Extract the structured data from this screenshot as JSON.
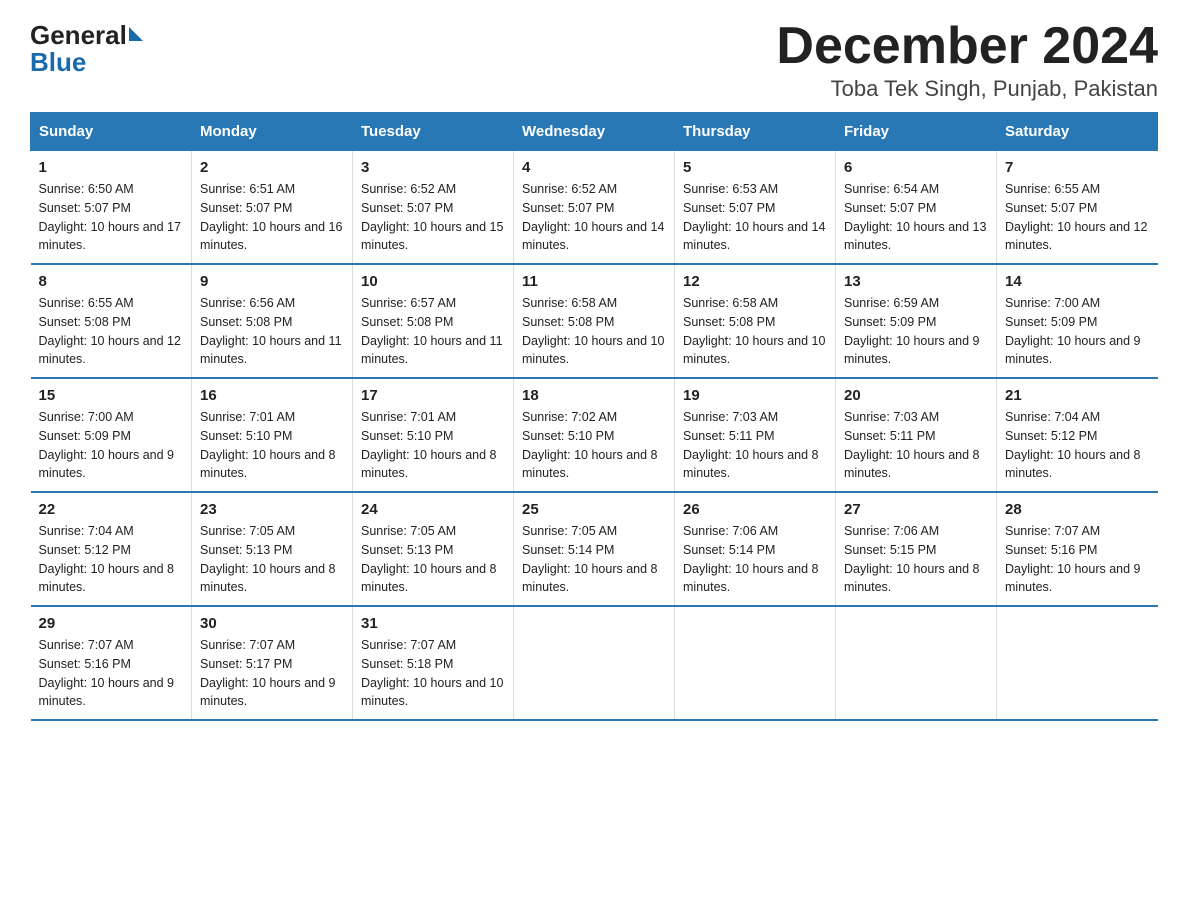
{
  "header": {
    "logo_general": "General",
    "logo_blue": "Blue",
    "month_title": "December 2024",
    "location": "Toba Tek Singh, Punjab, Pakistan"
  },
  "days_of_week": [
    "Sunday",
    "Monday",
    "Tuesday",
    "Wednesday",
    "Thursday",
    "Friday",
    "Saturday"
  ],
  "weeks": [
    [
      {
        "day": "1",
        "sunrise": "6:50 AM",
        "sunset": "5:07 PM",
        "daylight": "10 hours and 17 minutes."
      },
      {
        "day": "2",
        "sunrise": "6:51 AM",
        "sunset": "5:07 PM",
        "daylight": "10 hours and 16 minutes."
      },
      {
        "day": "3",
        "sunrise": "6:52 AM",
        "sunset": "5:07 PM",
        "daylight": "10 hours and 15 minutes."
      },
      {
        "day": "4",
        "sunrise": "6:52 AM",
        "sunset": "5:07 PM",
        "daylight": "10 hours and 14 minutes."
      },
      {
        "day": "5",
        "sunrise": "6:53 AM",
        "sunset": "5:07 PM",
        "daylight": "10 hours and 14 minutes."
      },
      {
        "day": "6",
        "sunrise": "6:54 AM",
        "sunset": "5:07 PM",
        "daylight": "10 hours and 13 minutes."
      },
      {
        "day": "7",
        "sunrise": "6:55 AM",
        "sunset": "5:07 PM",
        "daylight": "10 hours and 12 minutes."
      }
    ],
    [
      {
        "day": "8",
        "sunrise": "6:55 AM",
        "sunset": "5:08 PM",
        "daylight": "10 hours and 12 minutes."
      },
      {
        "day": "9",
        "sunrise": "6:56 AM",
        "sunset": "5:08 PM",
        "daylight": "10 hours and 11 minutes."
      },
      {
        "day": "10",
        "sunrise": "6:57 AM",
        "sunset": "5:08 PM",
        "daylight": "10 hours and 11 minutes."
      },
      {
        "day": "11",
        "sunrise": "6:58 AM",
        "sunset": "5:08 PM",
        "daylight": "10 hours and 10 minutes."
      },
      {
        "day": "12",
        "sunrise": "6:58 AM",
        "sunset": "5:08 PM",
        "daylight": "10 hours and 10 minutes."
      },
      {
        "day": "13",
        "sunrise": "6:59 AM",
        "sunset": "5:09 PM",
        "daylight": "10 hours and 9 minutes."
      },
      {
        "day": "14",
        "sunrise": "7:00 AM",
        "sunset": "5:09 PM",
        "daylight": "10 hours and 9 minutes."
      }
    ],
    [
      {
        "day": "15",
        "sunrise": "7:00 AM",
        "sunset": "5:09 PM",
        "daylight": "10 hours and 9 minutes."
      },
      {
        "day": "16",
        "sunrise": "7:01 AM",
        "sunset": "5:10 PM",
        "daylight": "10 hours and 8 minutes."
      },
      {
        "day": "17",
        "sunrise": "7:01 AM",
        "sunset": "5:10 PM",
        "daylight": "10 hours and 8 minutes."
      },
      {
        "day": "18",
        "sunrise": "7:02 AM",
        "sunset": "5:10 PM",
        "daylight": "10 hours and 8 minutes."
      },
      {
        "day": "19",
        "sunrise": "7:03 AM",
        "sunset": "5:11 PM",
        "daylight": "10 hours and 8 minutes."
      },
      {
        "day": "20",
        "sunrise": "7:03 AM",
        "sunset": "5:11 PM",
        "daylight": "10 hours and 8 minutes."
      },
      {
        "day": "21",
        "sunrise": "7:04 AM",
        "sunset": "5:12 PM",
        "daylight": "10 hours and 8 minutes."
      }
    ],
    [
      {
        "day": "22",
        "sunrise": "7:04 AM",
        "sunset": "5:12 PM",
        "daylight": "10 hours and 8 minutes."
      },
      {
        "day": "23",
        "sunrise": "7:05 AM",
        "sunset": "5:13 PM",
        "daylight": "10 hours and 8 minutes."
      },
      {
        "day": "24",
        "sunrise": "7:05 AM",
        "sunset": "5:13 PM",
        "daylight": "10 hours and 8 minutes."
      },
      {
        "day": "25",
        "sunrise": "7:05 AM",
        "sunset": "5:14 PM",
        "daylight": "10 hours and 8 minutes."
      },
      {
        "day": "26",
        "sunrise": "7:06 AM",
        "sunset": "5:14 PM",
        "daylight": "10 hours and 8 minutes."
      },
      {
        "day": "27",
        "sunrise": "7:06 AM",
        "sunset": "5:15 PM",
        "daylight": "10 hours and 8 minutes."
      },
      {
        "day": "28",
        "sunrise": "7:07 AM",
        "sunset": "5:16 PM",
        "daylight": "10 hours and 9 minutes."
      }
    ],
    [
      {
        "day": "29",
        "sunrise": "7:07 AM",
        "sunset": "5:16 PM",
        "daylight": "10 hours and 9 minutes."
      },
      {
        "day": "30",
        "sunrise": "7:07 AM",
        "sunset": "5:17 PM",
        "daylight": "10 hours and 9 minutes."
      },
      {
        "day": "31",
        "sunrise": "7:07 AM",
        "sunset": "5:18 PM",
        "daylight": "10 hours and 10 minutes."
      },
      null,
      null,
      null,
      null
    ]
  ]
}
